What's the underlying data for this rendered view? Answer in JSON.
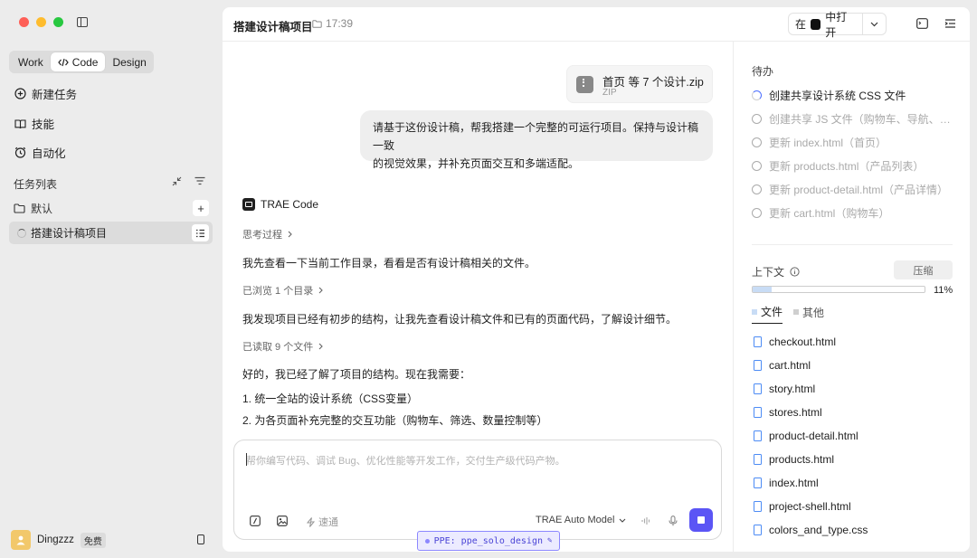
{
  "sidebar": {
    "modes": [
      "Work",
      "Code",
      "Design"
    ],
    "active_mode": "Code",
    "nav": {
      "new_task": "新建任务",
      "skills": "技能",
      "automation": "自动化"
    },
    "task_list_title": "任务列表",
    "folder_name": "默认",
    "current_task": "搭建设计稿项目",
    "user": {
      "name": "Dingzzz",
      "plan": "免费"
    }
  },
  "header": {
    "title": "搭建设计稿项目",
    "time": "17:39",
    "open_prefix": "在",
    "open_suffix": "中打开"
  },
  "chat": {
    "attachment": {
      "name": "首页 等 7 个设计.zip",
      "type": "ZIP"
    },
    "user_message_line1": "请基于这份设计稿，帮我搭建一个完整的可运行项目。保持与设计稿一致",
    "user_message_line2": "的视觉效果，并补充页面交互和多端适配。",
    "agent_name": "TRAE Code",
    "thinking_label": "思考过程",
    "msg1": "我先查看一下当前工作目录，看看是否有设计稿相关的文件。",
    "browsed_label": "已浏览 1 个目录",
    "msg2": "我发现项目已经有初步的结构，让我先查看设计稿文件和已有的页面代码，了解设计细节。",
    "read_label": "已读取 9 个文件",
    "msg3": "好的，我已经了解了项目的结构。现在我需要：",
    "msg4": "1. 统一全站的设计系统（CSS变量）",
    "msg5": "2. 为各页面补充完整的交互功能（购物车、筛选、数量控制等）"
  },
  "composer": {
    "placeholder": "帮你编写代码、调试 Bug、优化性能等开发工作，交付生产级代码产物。",
    "speed_label": "速通",
    "model_label": "TRAE Auto Model",
    "ppe_label": "PPE: ppe_solo_design"
  },
  "panel": {
    "todo_title": "待办",
    "todos": [
      "创建共享设计系统 CSS 文件",
      "创建共享 JS 文件（购物车、导航、交互）",
      "更新 index.html（首页）",
      "更新 products.html（产品列表）",
      "更新 product-detail.html（产品详情）",
      "更新 cart.html（购物车）"
    ],
    "context_title": "上下文",
    "compress_label": "压缩",
    "context_percent": "11%",
    "context_fraction": 0.11,
    "tab_files": "文件",
    "tab_other": "其他",
    "files": [
      "checkout.html",
      "cart.html",
      "story.html",
      "stores.html",
      "product-detail.html",
      "products.html",
      "index.html",
      "project-shell.html",
      "colors_and_type.css"
    ]
  },
  "colors": {
    "accent": "#5b55f5",
    "file_icon": "#4c8bf5",
    "traffic_red": "#fe5f57",
    "traffic_yellow": "#febc2e",
    "traffic_green": "#28c840"
  }
}
